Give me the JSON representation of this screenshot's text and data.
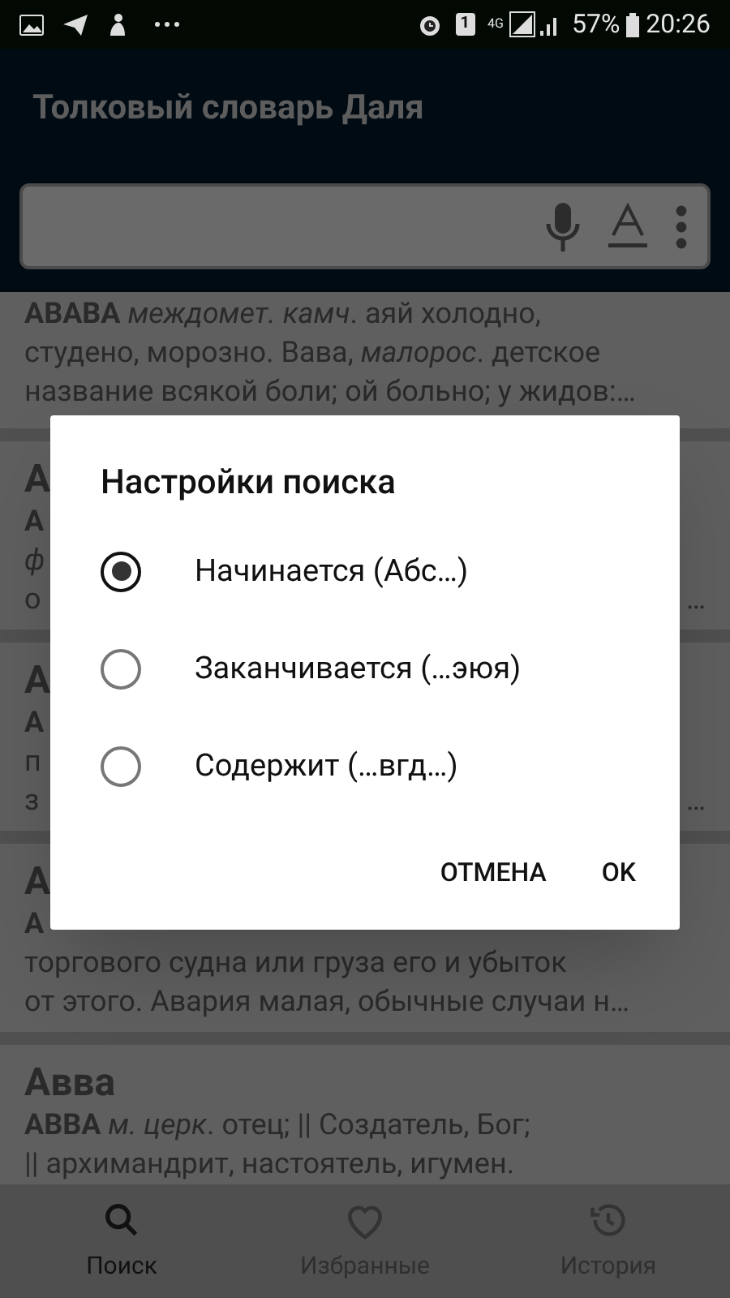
{
  "status_bar": {
    "sim": "1",
    "network": "4G",
    "battery": "57%",
    "time": "20:26"
  },
  "app_bar": {
    "title": "Толковый словарь Даля"
  },
  "cards": [
    {
      "lines": [
        "**АВАВА** *междомет. камч*. аяй холодно,",
        "студено, морозно. Вава, *малорос*. детское",
        "название всякой боли; ой больно; у жидов:…"
      ]
    },
    {
      "title": "А",
      "lines": [
        "**А**",
        "*ф*",
        "о"
      ],
      "trailing": "…"
    },
    {
      "title": "А",
      "lines": [
        "**А**",
        "п",
        "з"
      ],
      "trailing": "…"
    },
    {
      "title": "А",
      "lines": [
        "**А**",
        "торгового судна или груза его и убыток",
        "от этого. Авария малая, обычные случаи н…"
      ]
    },
    {
      "title": "Авва",
      "lines": [
        "**АВВА** *м. церк*. отец; || Создатель, Бог;",
        "|| архимандрит, настоятель, игумен."
      ]
    }
  ],
  "dialog": {
    "title": "Настройки поиска",
    "options": [
      {
        "label": "Начинается (Абс…)",
        "selected": true
      },
      {
        "label": "Заканчивается (…эюя)",
        "selected": false
      },
      {
        "label": "Содержит (…вгд…)",
        "selected": false
      }
    ],
    "buttons": [
      "ОТМЕНА",
      "OK"
    ]
  },
  "bottom_nav": [
    {
      "label": "Поиск",
      "selected": true
    },
    {
      "label": "Избранные",
      "selected": false
    },
    {
      "label": "История",
      "selected": false
    }
  ]
}
